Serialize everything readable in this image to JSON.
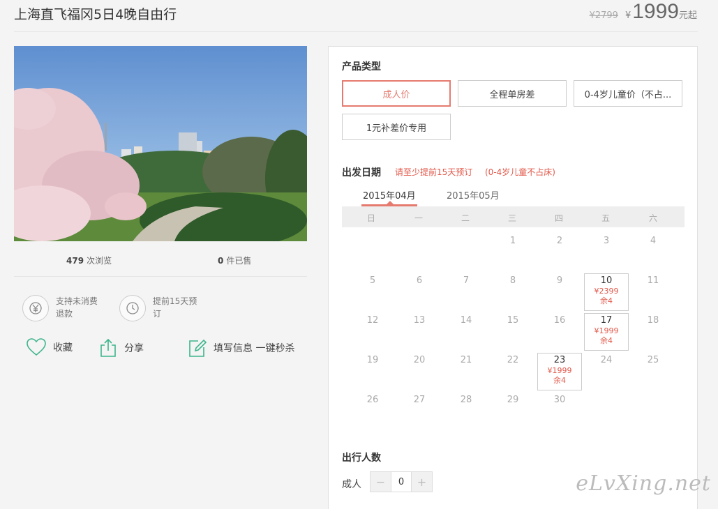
{
  "header": {
    "title": "上海直飞福冈5日4晚自由行",
    "old_price": "¥2799",
    "currency": "¥",
    "price": "1999",
    "price_suffix": "元起"
  },
  "stats": {
    "views_count": "479",
    "views_label": "次浏览",
    "sold_count": "0",
    "sold_label": "件已售"
  },
  "features": [
    {
      "icon": "yen-refund-icon",
      "text": "支持未消费退款"
    },
    {
      "icon": "clock-icon",
      "text": "提前15天预订"
    }
  ],
  "actions": {
    "favorite": "收藏",
    "share": "分享",
    "fill_info": "填写信息 一键秒杀"
  },
  "product_type": {
    "title": "产品类型",
    "options": [
      "成人价",
      "全程单房差",
      "0-4岁儿童价（不占...",
      "1元补差价专用"
    ],
    "selected": "成人价"
  },
  "departure": {
    "title": "出发日期",
    "hint1": "请至少提前15天预订",
    "hint2": "(0-4岁儿童不占床)",
    "tabs": [
      "2015年04月",
      "2015年05月"
    ],
    "active_tab": "2015年04月",
    "weekdays": [
      "日",
      "一",
      "二",
      "三",
      "四",
      "五",
      "六"
    ],
    "priced_days": [
      {
        "day": "10",
        "price": "¥2399",
        "remain": "余4"
      },
      {
        "day": "17",
        "price": "¥1999",
        "remain": "余4"
      },
      {
        "day": "23",
        "price": "¥1999",
        "remain": "余4"
      }
    ]
  },
  "travelers": {
    "title": "出行人数",
    "adult_label": "成人",
    "adult_count": "0",
    "minus": "−",
    "plus": "+"
  },
  "watermark": "eLvXing.net",
  "colors": {
    "accent": "#e67a6e",
    "hint": "#e2584a",
    "icon_green": "#3cb48c"
  }
}
